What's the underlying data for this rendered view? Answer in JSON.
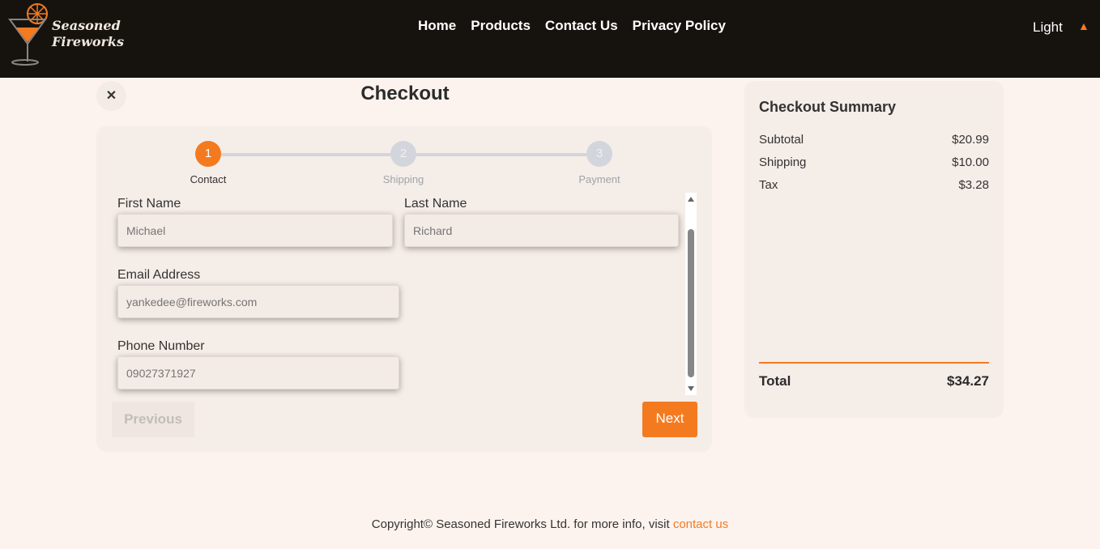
{
  "brand": {
    "line1": "Seasoned",
    "line2": "Fireworks",
    "accent": "#f47a20"
  },
  "nav": {
    "items": [
      "Home",
      "Products",
      "Contact Us",
      "Privacy Policy"
    ]
  },
  "theme": {
    "label": "Light",
    "arrow_icon": "triangle-up-icon"
  },
  "checkout": {
    "title": "Checkout",
    "close_icon": "close-icon",
    "steps": [
      {
        "number": "1",
        "label": "Contact",
        "state": "active"
      },
      {
        "number": "2",
        "label": "Shipping",
        "state": "inactive"
      },
      {
        "number": "3",
        "label": "Payment",
        "state": "inactive"
      }
    ],
    "fields": {
      "first_name": {
        "label": "First Name",
        "placeholder": "Michael"
      },
      "last_name": {
        "label": "Last Name",
        "placeholder": "Richard"
      },
      "email": {
        "label": "Email Address",
        "placeholder": "yankedee@fireworks.com"
      },
      "phone": {
        "label": "Phone Number",
        "placeholder": "09027371927"
      }
    },
    "buttons": {
      "previous": "Previous",
      "next": "Next"
    }
  },
  "summary": {
    "title": "Checkout Summary",
    "rows": [
      {
        "label": "Subtotal",
        "value": "$20.99"
      },
      {
        "label": "Shipping",
        "value": "$10.00"
      },
      {
        "label": "Tax",
        "value": "$3.28"
      }
    ],
    "total": {
      "label": "Total",
      "value": "$34.27"
    }
  },
  "footer": {
    "text": "Copyright© Seasoned Fireworks Ltd. for more info, visit",
    "link": "contact us"
  }
}
